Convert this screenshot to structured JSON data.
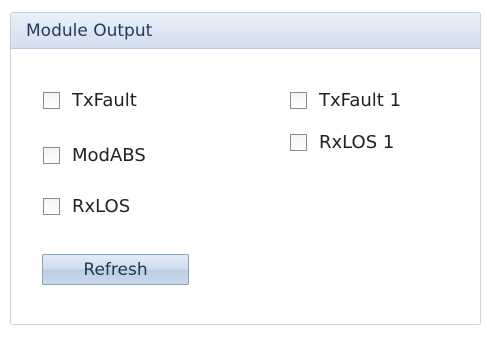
{
  "panel": {
    "title": "Module Output",
    "checkboxes": [
      {
        "label": "TxFault",
        "checked": false
      },
      {
        "label": "ModABS",
        "checked": false
      },
      {
        "label": "RxLOS",
        "checked": false
      },
      {
        "label": "TxFault 1",
        "checked": false
      },
      {
        "label": "RxLOS 1",
        "checked": false
      }
    ],
    "refresh_label": "Refresh"
  },
  "colors": {
    "header_gradient_top": "#e9f0f8",
    "header_gradient_bottom": "#d3dfee",
    "border": "#c9d3df",
    "button_border": "#8aa3c2"
  }
}
